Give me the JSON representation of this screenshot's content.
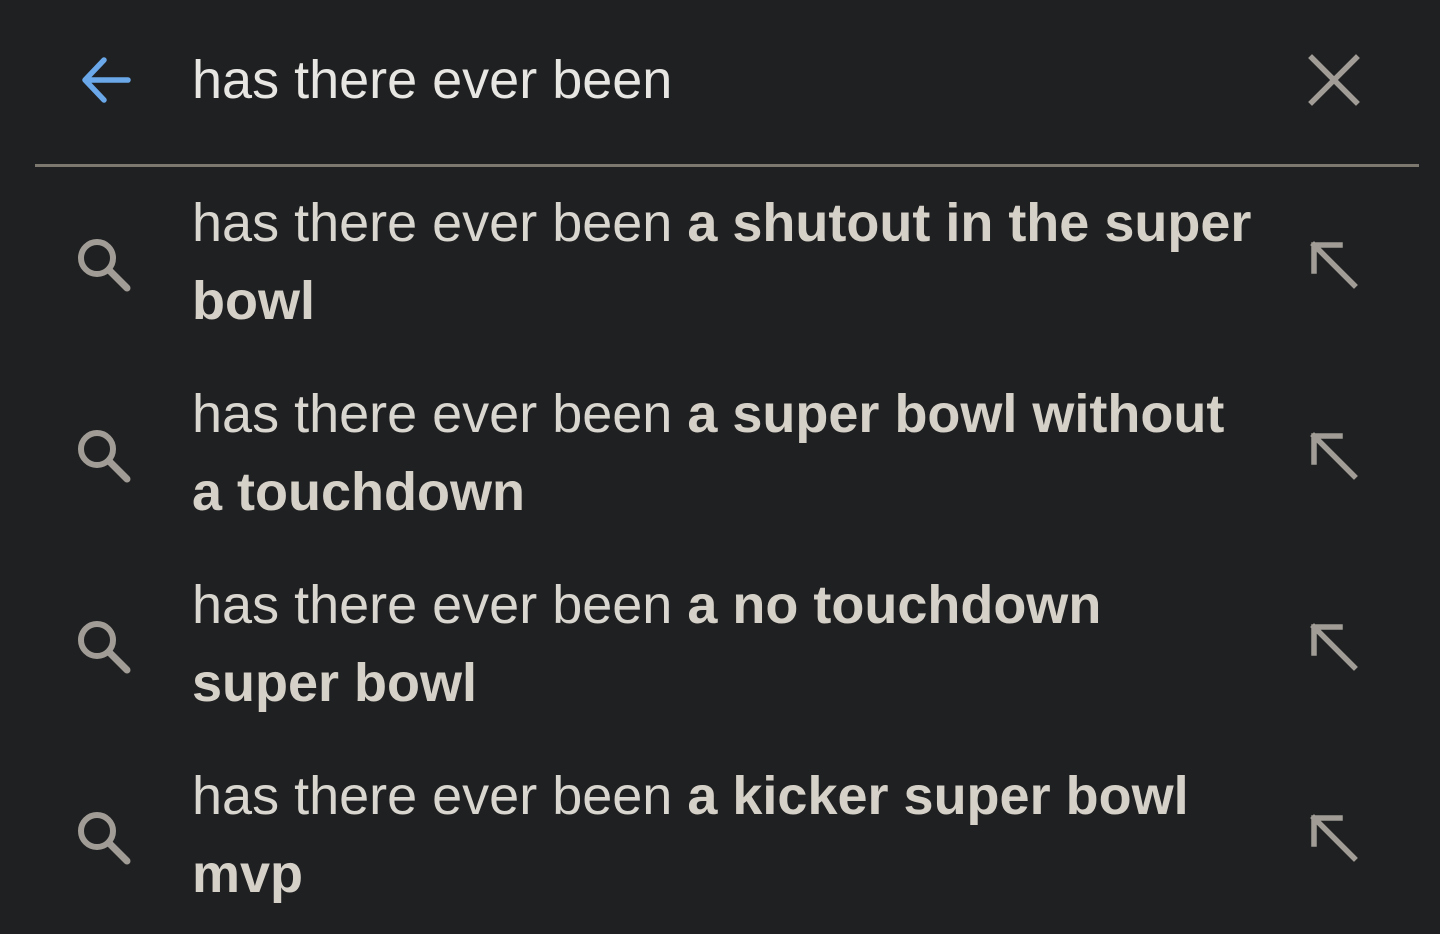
{
  "search": {
    "query": "has there ever been"
  },
  "icons": {
    "back": "arrow-left-icon",
    "clear": "close-icon",
    "suggestion": "search-icon",
    "fill": "arrow-up-left-icon"
  },
  "colors": {
    "background": "#1f2022",
    "accent": "#6aa8ea",
    "text": "#e8e6e3",
    "completion_text": "#d6d1c8",
    "icon_gray": "#a19d96",
    "divider": "#7c786f"
  },
  "suggestions": [
    {
      "prefix": "has there ever been",
      "completion": "a shutout in the super bowl"
    },
    {
      "prefix": "has there ever been",
      "completion": "a super bowl without a touchdown"
    },
    {
      "prefix": "has there ever been",
      "completion": "a no touchdown super bowl"
    },
    {
      "prefix": "has there ever been",
      "completion": "a kicker super bowl mvp"
    }
  ]
}
